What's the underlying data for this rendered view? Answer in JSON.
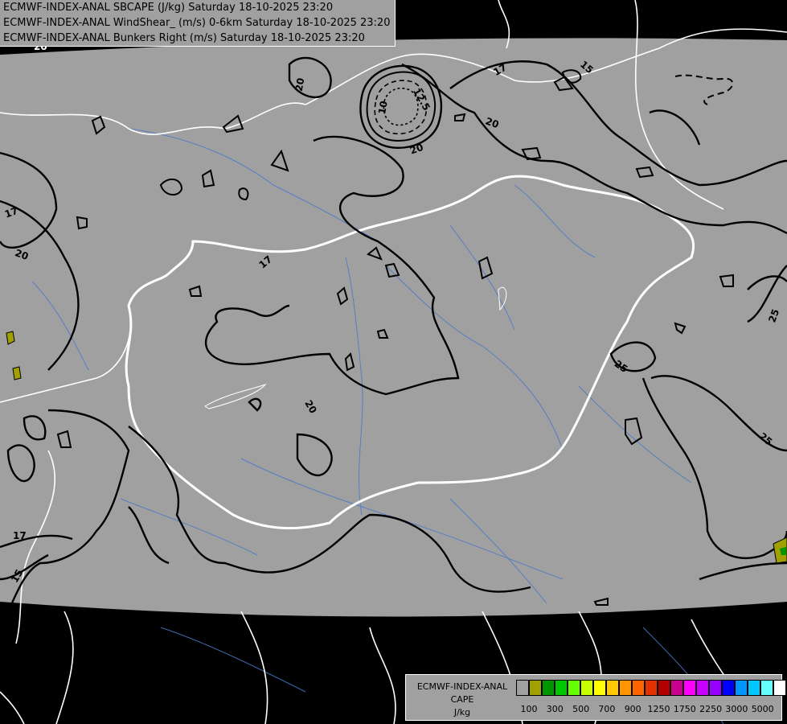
{
  "header": {
    "line1": "ECMWF-INDEX-ANAL SBCAPE (J/kg) Saturday 18-10-2025 23:20",
    "line2": "ECMWF-INDEX-ANAL WindShear_ (m/s) 0-6km Saturday 18-10-2025 23:20",
    "line3": "ECMWF-INDEX-ANAL Bunkers Right (m/s) Saturday 18-10-2025 23:20"
  },
  "legend": {
    "line1": "ECMWF-INDEX-ANAL",
    "line2": "CAPE",
    "line3": "J/kg",
    "colors": [
      "#a0a0a0",
      "#a0a000",
      "#009600",
      "#00c800",
      "#64ff00",
      "#c8ff00",
      "#ffff00",
      "#ffc800",
      "#ff9600",
      "#ff6400",
      "#e13200",
      "#b40000",
      "#c8008c",
      "#ff00ff",
      "#c800ff",
      "#9600ff",
      "#0000ff",
      "#0096ff",
      "#00c8ff",
      "#64ffff",
      "#ffffff"
    ],
    "ticks": [
      "100",
      "300",
      "500",
      "700",
      "900",
      "1250",
      "1750",
      "2250",
      "3000",
      "5000"
    ]
  },
  "map": {
    "contour_labels": [
      "20",
      "20",
      "17",
      "17",
      "15",
      "20",
      "20",
      "17",
      "15",
      "25",
      "25",
      "25",
      "20",
      "10",
      "12.5",
      "20",
      "17",
      "15"
    ]
  }
}
